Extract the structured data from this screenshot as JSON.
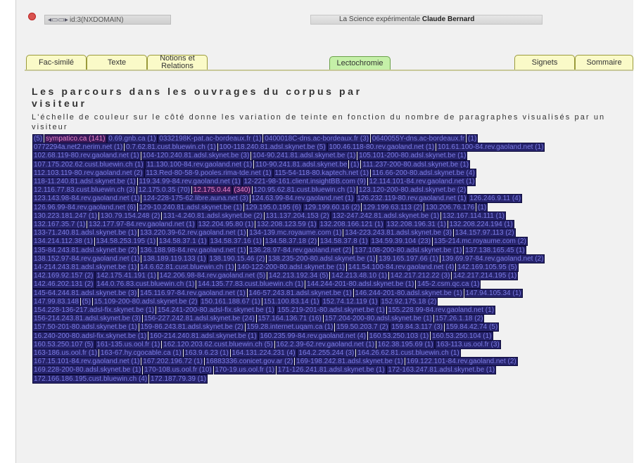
{
  "header": {
    "id_label": "id:3(NXDOMAIN)",
    "site_title_prefix": "La Science expérimentale",
    "site_title_author": "Claude Bernard"
  },
  "tabs": [
    {
      "label": "Fac-similé",
      "active": false
    },
    {
      "label": "Texte",
      "active": false
    },
    {
      "label": "Notions et Relations",
      "active": false
    },
    {
      "label": "Lectochromie",
      "active": true
    },
    {
      "label": "Signets",
      "active": false
    },
    {
      "label": "Sommaire",
      "active": false
    }
  ],
  "heading": "Les parcours dans les ouvrages du corpus par visiteur",
  "legend_text": "L'échelle de couleur sur le côté donne les variation de teinte en fonction du nombre de paragraphes visualisés par un visiteur",
  "colors": {
    "tab_bg": "#fafac8",
    "tab_active_bg": "#c5f0a8",
    "chip_bg": "#26236b",
    "chip_text": "#7c7ce4"
  },
  "visitors": [
    {
      "t": "(5)"
    },
    {
      "t": "sympatico.ca (141)",
      "hot": true
    },
    {
      "t": "0.69.gnb.ca (1)"
    },
    {
      "t": "0332198K-pat.ac-bordeaux.fr (1)"
    },
    {
      "t": "0400018C-dns.ac-bordeaux.fr (3)"
    },
    {
      "t": "0640055Y-dns.ac-bordeaux.fr"
    },
    {
      "t": "(1)"
    },
    {
      "t": "0772294a.net2.nerim.net (1)"
    },
    {
      "t": "0.7.62.81.cust.bluewin.ch (1)"
    },
    {
      "t": "100-118.240.81.adsl.skynet.be (5)"
    },
    {
      "t": "100.46.118-80.rev.gaoland.net (1)"
    },
    {
      "t": "101.61.100-84.rev.gaoland.net (1)"
    },
    {
      "t": "102.68.119-80.rev.gaoland.net (1)"
    },
    {
      "t": "104-120.240.81.adsl.skynet.be (3)"
    },
    {
      "t": "104-90.241.81.adsl.skynet.be (1)"
    },
    {
      "t": "105.101-200-80.adsl.skynet.be (1)"
    },
    {
      "t": "107.175.202.62.cust.bluewin.ch (1)"
    },
    {
      "t": "11.130.100-84.rev.gaoland.net (1)"
    },
    {
      "t": "110-90.241.81.adsl.skynet.be"
    },
    {
      "t": "(1)"
    },
    {
      "t": "111.237-200-80.adsl.skynet.be (1)"
    },
    {
      "t": "112.103.119-80.rev.gaoland.net (2)"
    },
    {
      "t": "113.Red-80-58-9.pooles.rima-tde.net (1)"
    },
    {
      "t": "115-54-118-80.kaptech.net (1)"
    },
    {
      "t": "116.66-200-80.adsl.skynet.be (4)"
    },
    {
      "t": "118-11.240.81.adsl.skynet.be (1)"
    },
    {
      "t": "119.34.99-84.rev.gaoland.net (1)"
    },
    {
      "t": "12-221-98-161.client.insightBB.com (9)"
    },
    {
      "t": "12.114.101-84.rev.gaoland.net (1)"
    },
    {
      "t": "12.116.77.83.cust.bluewin.ch (3)"
    },
    {
      "t": "12.175.0.35 (70)"
    },
    {
      "t": "12.175.0.44",
      "hot": true
    },
    {
      "t": "(340)",
      "hot": true
    },
    {
      "t": "120.95.62.81.cust.bluewin.ch (1)"
    },
    {
      "t": "123.120-200-80.adsl.skynet.be (2)"
    },
    {
      "t": "123.143.98-84.rev.gaoland.net (1)"
    },
    {
      "t": "124-228-175-62.libre.auna.net (3)"
    },
    {
      "t": "124.63.99-84.rev.gaoland.net (1)"
    },
    {
      "t": "126.232.119-80.rev.gaoland.net (1)"
    },
    {
      "t": "126.246.9.11 (4)"
    },
    {
      "t": "126.96.99-84.rev.gaoland.net (6)"
    },
    {
      "t": "129-10.240.81.adsl.skynet.be (1)"
    },
    {
      "t": "129.195.0.195 (6)"
    },
    {
      "t": "129.199.60.16 (2)"
    },
    {
      "t": "129.199.63.113 (2)"
    },
    {
      "t": "130.206.76.176"
    },
    {
      "t": "(1)"
    },
    {
      "t": "130.223.181.247 (1)"
    },
    {
      "t": "130.79.154.248 (2)"
    },
    {
      "t": "131-4.240.81.adsl.skynet.be (2)"
    },
    {
      "t": "131.137.204.153 (2)"
    },
    {
      "t": "132-247.242.81.adsl.skynet.be (1)"
    },
    {
      "t": "132.167.114.111 (1)"
    },
    {
      "t": "132.167.35.7 (1)"
    },
    {
      "t": "132.177.97-84.rev.gaoland.net (1)"
    },
    {
      "t": "132.204.95.80 (1)"
    },
    {
      "t": "132.208.123.59 (1)"
    },
    {
      "t": "132.208.166.121 (1)"
    },
    {
      "t": "132.208.196.31 (1)"
    },
    {
      "t": "132.208.224.194 (1)"
    },
    {
      "t": "133-71.240.81.adsl.skynet.be (1)"
    },
    {
      "t": "133.220.39-62.rev.gaoland.net (1)"
    },
    {
      "t": "134-139.mc.royaume.com (1)"
    },
    {
      "t": "134-223.243.81.adsl.skynet.be (3)"
    },
    {
      "t": "134.157.97.113 (2)"
    },
    {
      "t": "134.214.112.38 (1)"
    },
    {
      "t": "134.58.253.195 (1)"
    },
    {
      "t": "134.58.37.1 (1)"
    },
    {
      "t": "134.58.37.16 (1)"
    },
    {
      "t": "134.58.37.18 (2)"
    },
    {
      "t": "134.58.37.8 (1)"
    },
    {
      "t": "134.59.39.104 (23)"
    },
    {
      "t": "135-214.mc.royaume.com (2)"
    },
    {
      "t": "135-84.243.81.adsl.skynet.be (2)"
    },
    {
      "t": "136.188.98-84.rev.gaoland.net (1)"
    },
    {
      "t": "136.28.97-84.rev.gaoland.net (2)"
    },
    {
      "t": "137.108-200-80.adsl.skynet.be (1)"
    },
    {
      "t": "137.138.165.45 (1)"
    },
    {
      "t": "138.152.97-84.rev.gaoland.net (1)"
    },
    {
      "t": "138.189.119.133 (1)"
    },
    {
      "t": "138.190.15.46 (2)"
    },
    {
      "t": "138.235-200-80.adsl.skynet.be (1)"
    },
    {
      "t": "139.165.197.66 (1)"
    },
    {
      "t": "139.69.97-84.rev.gaoland.net (2)"
    },
    {
      "t": "14-214.243.81.adsl.skynet.be (1)"
    },
    {
      "t": "14.6.62.81.cust.bluewin.ch (1)"
    },
    {
      "t": "140-122-200-80.adsl.skynet.be (1)"
    },
    {
      "t": "141.54.100-84.rev.gaoland.net (4)"
    },
    {
      "t": "142.169.105.95 (5)"
    },
    {
      "t": "142.169.92.157 (2)"
    },
    {
      "t": "142.175.41.191 (1)"
    },
    {
      "t": "142.206.98-84.rev.gaoland.net (5)"
    },
    {
      "t": "142.213.192.34 (5)"
    },
    {
      "t": "142.213.48.10 (1)"
    },
    {
      "t": "142.217.212.22 (3)"
    },
    {
      "t": "142.217.214.195 (1)"
    },
    {
      "t": "142.46.202.131 (2)"
    },
    {
      "t": "144.0.76.83.cust.bluewin.ch (1)"
    },
    {
      "t": "144.135.77.83.cust.bluewin.ch (1)"
    },
    {
      "t": "144.244-201-80.adsl.skynet.be (1)"
    },
    {
      "t": "145-2.csm.qc.ca (1)"
    },
    {
      "t": "145-64.244.81.adsl.skynet.be (3)"
    },
    {
      "t": "145.116.97-84.rev.gaoland.net (1)"
    },
    {
      "t": "146-57.243.81.adsl.skynet.be (1)"
    },
    {
      "t": "146.244-201-80.adsl.skynet.be (1)"
    },
    {
      "t": "147.94.105.34 (1)"
    },
    {
      "t": "147.99.83.148"
    },
    {
      "t": "(5)"
    },
    {
      "t": "15.109-200-80.adsl.skynet.be (2)"
    },
    {
      "t": "150.161.188.67 (1)"
    },
    {
      "t": "151.100.83.14 (1)"
    },
    {
      "t": "152.74.12.119 (1)"
    },
    {
      "t": "152.92.175.18 (2)"
    },
    {
      "t": "154.228-136-217.adsl-fix.skynet.be (1)"
    },
    {
      "t": "154.241-200-80.adsl-fix.skynet.be (1)"
    },
    {
      "t": "155.219-201-80.adsl.skynet.be (1)"
    },
    {
      "t": "155.228.99-84.rev.gaoland.net (1)"
    },
    {
      "t": "156-214.243.81.adsl.skynet.be (3)"
    },
    {
      "t": "156-227.242.81.adsl.skynet.be (24)"
    },
    {
      "t": "157.164.136.71 (16)"
    },
    {
      "t": "157.204-200-80.adsl.skynet.be (1)"
    },
    {
      "t": "157.26.1.18 (2)"
    },
    {
      "t": "157.50-201-80.adsl.skynet.be (1)"
    },
    {
      "t": "159-86.243.81.adsl.skynet.be (2)"
    },
    {
      "t": "159.28.internet.uqam.ca (1)"
    },
    {
      "t": "159.50.203.7 (2)"
    },
    {
      "t": "159.84.3.117 (3)"
    },
    {
      "t": "159.84.42.74 (5)"
    },
    {
      "t": "16.240-200-80.adsl-fix.skynet.be (1)"
    },
    {
      "t": "160-214.240.81.adsl.skynet.be (1)"
    },
    {
      "t": "160.235.99-84.rev.gaoland.net (4)"
    },
    {
      "t": "160.53.250.103 (1)"
    },
    {
      "t": "160.53.250.104 (1)"
    },
    {
      "t": "160.53.250.107 (5)"
    },
    {
      "t": "161-135.us.ool.fr (1)"
    },
    {
      "t": "162.120.203.62.cust.bluewin.ch (5)"
    },
    {
      "t": "162.2.39-62.rev.gaoland.net (1)"
    },
    {
      "t": "162.38.195.69 (1)"
    },
    {
      "t": "163-113.us.ool.fr (3)"
    },
    {
      "t": "163-186.us.ool.fr (1)"
    },
    {
      "t": "163-67.hy.cgocable.ca (1)"
    },
    {
      "t": "163.9.6.23 (1)"
    },
    {
      "t": "164.131.224.231 (4)"
    },
    {
      "t": "164.2.255.244 (3)"
    },
    {
      "t": "164.26.62.81.cust.bluewin.ch (1)"
    },
    {
      "t": "167.15.101-84.rev.gaoland.net (1)"
    },
    {
      "t": "167.202.196.72 (1)"
    },
    {
      "t": "16883336.conicet.gov.ar (2)"
    },
    {
      "t": "169-198.242.81.adsl.skynet.be (1)"
    },
    {
      "t": "169.122.101-84.rev.gaoland.net (2)"
    },
    {
      "t": "169.228-200-80.adsl.skynet.be (1)"
    },
    {
      "t": "170-108.us.ool.fr (10)"
    },
    {
      "t": "170-19.us.ool.fr (1)"
    },
    {
      "t": "171-126.241.81.adsl.skynet.be (1)"
    },
    {
      "t": "172-163.247.81.adsl.skynet.be (1)"
    },
    {
      "t": "172.166.186.195.cust.bluewin.ch (4)"
    },
    {
      "t": "172.187.79.39 (1)"
    }
  ]
}
